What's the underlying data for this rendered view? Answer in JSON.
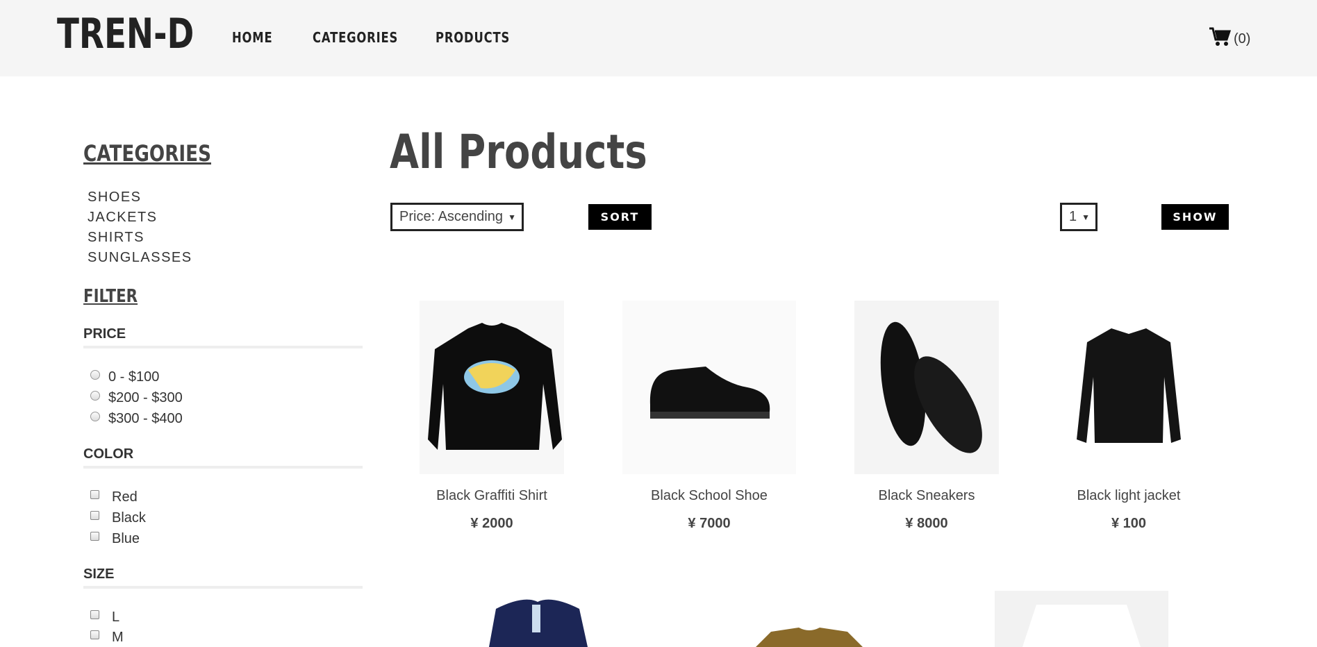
{
  "header": {
    "logo": "TREN-D",
    "nav": [
      "HOME",
      "CATEGORIES",
      "PRODUCTS"
    ],
    "cart_count": "(0)",
    "cart_icon": "shopping-cart-icon"
  },
  "sidebar": {
    "categories_title": "CATEGORIES",
    "categories": [
      "SHOES",
      "JACKETS",
      "SHIRTS",
      "SUNGLASSES"
    ],
    "filter_title": "FILTER",
    "price_title": "PRICE",
    "price_options": [
      "0 - $100",
      "$200 - $300",
      "$300 - $400"
    ],
    "color_title": "COLOR",
    "color_options": [
      "Red",
      "Black",
      "Blue"
    ],
    "size_title": "SIZE",
    "size_options": [
      "L",
      "M"
    ]
  },
  "main": {
    "title": "All Products",
    "sort_select": "Price: Ascending",
    "sort_button": "SORT",
    "show_select": "1",
    "show_button": "SHOW",
    "products": [
      {
        "name": "Black Graffiti Shirt",
        "price": "¥ 2000"
      },
      {
        "name": "Black School Shoe",
        "price": "¥ 7000"
      },
      {
        "name": "Black Sneakers",
        "price": "¥ 8000"
      },
      {
        "name": "Black light jacket",
        "price": "¥ 100"
      }
    ]
  }
}
